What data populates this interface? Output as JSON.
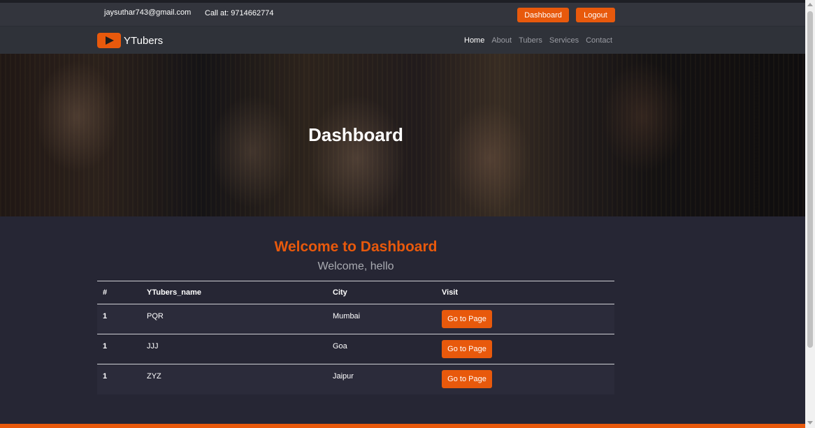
{
  "topbar": {
    "email": "jaysuthar743@gmail.com",
    "phone": "Call at: 9714662774",
    "dashboard_label": "Dashboard",
    "logout_label": "Logout"
  },
  "navbar": {
    "brand": "YTubers",
    "links": [
      "Home",
      "About",
      "Tubers",
      "Services",
      "Contact"
    ],
    "active": "Home"
  },
  "hero": {
    "title": "Dashboard"
  },
  "main": {
    "welcome": "Welcome to Dashboard",
    "greeting": "Welcome, hello"
  },
  "table": {
    "headers": [
      "#",
      "YTubers_name",
      "City",
      "Visit"
    ],
    "rows": [
      {
        "num": "1",
        "name": "PQR",
        "city": "Mumbai",
        "visit": "Go to Page"
      },
      {
        "num": "1",
        "name": "JJJ",
        "city": "Goa",
        "visit": "Go to Page"
      },
      {
        "num": "1",
        "name": "ZYZ",
        "city": "Jaipur",
        "visit": "Go to Page"
      }
    ]
  },
  "colors": {
    "accent": "#e8590c",
    "background": "#262634",
    "topbar": "#33353d",
    "navbar": "#2f3239"
  },
  "icons": {
    "logo": "youtube-play-icon"
  }
}
